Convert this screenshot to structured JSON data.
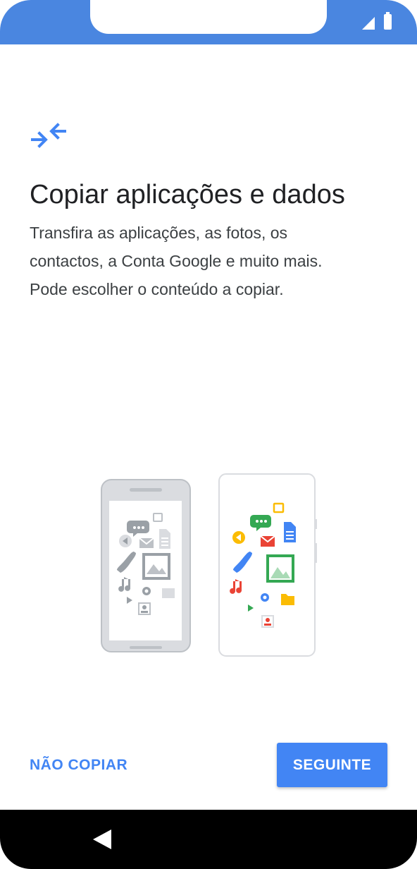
{
  "status_bar": {
    "signal_icon": "signal-icon",
    "battery_icon": "battery-icon",
    "color": "#4a86e0"
  },
  "header": {
    "icon": "transfer-arrows-icon",
    "title": "Copiar aplicações e dados",
    "description_lines": [
      "Transfira as aplicações, as fotos, os",
      "contactos, a Conta Google e muito mais.",
      "Pode escolher o conteúdo a copiar."
    ]
  },
  "illustration": {
    "name": "old-phone-to-new-phone-illustration",
    "accent_colors": [
      "#4285f4",
      "#ea4335",
      "#fbbc04",
      "#34a853"
    ]
  },
  "actions": {
    "skip_label": "NÃO COPIAR",
    "next_label": "SEGUINTE",
    "accent": "#4285f4"
  },
  "nav_bar": {
    "back_icon": "back-icon"
  }
}
